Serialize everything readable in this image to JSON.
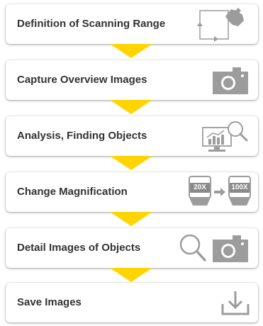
{
  "steps": [
    {
      "label": "Definition of Scanning Range",
      "icon": "scan-range-icon"
    },
    {
      "label": "Capture Overview Images",
      "icon": "camera-icon"
    },
    {
      "label": "Analysis, Finding Objects",
      "icon": "monitor-search-icon"
    },
    {
      "label": "Change Magnification",
      "icon": "objective-change-icon",
      "from_magnification": "20X",
      "to_magnification": "100X"
    },
    {
      "label": "Detail Images of Objects",
      "icon": "search-camera-icon"
    },
    {
      "label": "Save Images",
      "icon": "download-icon"
    }
  ],
  "colors": {
    "arrow": "#ffd400",
    "icon": "#9c9c9c",
    "text": "#333333"
  }
}
